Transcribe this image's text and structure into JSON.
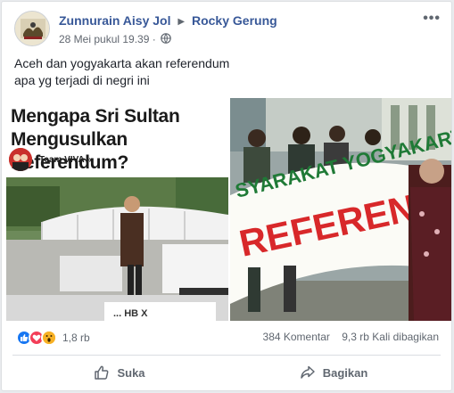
{
  "post": {
    "author": "Zunnurain Aisy Jol",
    "target": "Rocky Gerung",
    "timestamp": "28 Mei pukul 19.39",
    "separator": "·",
    "privacy_icon": "globe-icon",
    "more_icon": "more-options-icon",
    "text_lines": [
      "Aceh dan yogyakarta akan referendum",
      "apa yg terjadi di negri ini"
    ]
  },
  "left_image": {
    "headline_line1": "Mengapa Sri Sultan",
    "headline_line2": "Mengusulkan Referendum?",
    "team_label": "Team VIVA »",
    "banner_fragment": "... HB X"
  },
  "right_image": {
    "banner_top": "SYARAKAT YOGYAKARTA",
    "banner_main": "REFERENDUM"
  },
  "reactions": {
    "types": [
      "like",
      "love",
      "wow"
    ],
    "count": "1,8 rb"
  },
  "stats": {
    "comments": "384 Komentar",
    "shares": "9,3 rb Kali dibagikan"
  },
  "actions": {
    "like_label": "Suka",
    "share_label": "Bagikan"
  },
  "colors": {
    "link_blue": "#385898",
    "like_blue": "#1877f2",
    "love_red": "#f33e58",
    "wow_yellow": "#f7b125",
    "banner_red": "#d8282a",
    "banner_green": "#1f7a36"
  }
}
